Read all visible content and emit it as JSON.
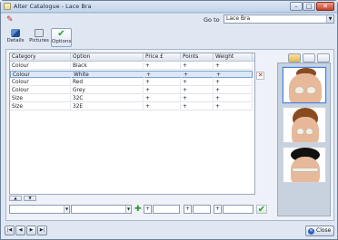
{
  "window": {
    "title": "Alter Catalogue - Lace Bra"
  },
  "goto": {
    "label": "Go to",
    "value": "Lace Bra"
  },
  "tabs": [
    {
      "label": "Details"
    },
    {
      "label": "Pictures"
    },
    {
      "label": "Options"
    }
  ],
  "grid": {
    "headers": [
      "Category",
      "Option",
      "Price  £",
      "Points",
      "Weight"
    ],
    "rows": [
      [
        "Colour",
        "Black",
        "+",
        "+",
        "+"
      ],
      [
        "Colour",
        "White",
        "+",
        "+",
        "+"
      ],
      [
        "Colour",
        "Red",
        "+",
        "+",
        "+"
      ],
      [
        "Colour",
        "Grey",
        "+",
        "+",
        "+"
      ],
      [
        "Size",
        "32C",
        "+",
        "+",
        "+"
      ],
      [
        "Size",
        "32E",
        "+",
        "+",
        "+"
      ]
    ],
    "selected_row": 1
  },
  "editor": {
    "sign1": "+",
    "sign2": "+",
    "sign3": "+"
  },
  "footer": {
    "close_label": "Close"
  },
  "icons": {
    "pin": "pin-icon",
    "delete": "delete-icon",
    "add": "add-icon",
    "confirm": "check-icon"
  }
}
